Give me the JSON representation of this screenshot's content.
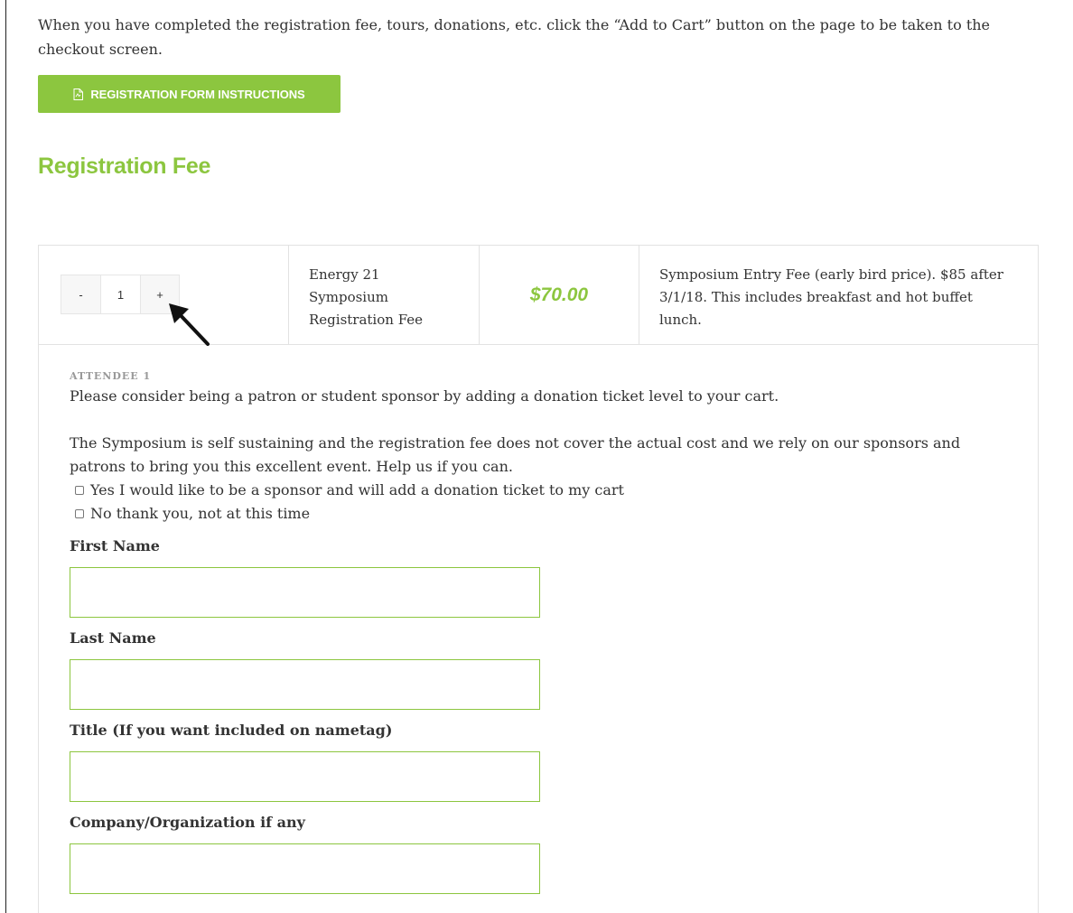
{
  "intro": {
    "text": "When you have completed the registration fee, tours, donations, etc. click the “Add to Cart” button on the page to be taken to the checkout screen."
  },
  "instructions_button": {
    "label": "REGISTRATION FORM INSTRUCTIONS",
    "icon": "pdf-file-icon"
  },
  "section": {
    "title": "Registration Fee"
  },
  "ticket": {
    "quantity": {
      "minus": "-",
      "value": "1",
      "plus": "+"
    },
    "name_lines": [
      "Energy 21",
      "Symposium",
      "Registration Fee"
    ],
    "price": "$70.00",
    "description": "Symposium Entry Fee (early bird price). $85 after 3/1/18. This includes breakfast and hot buffet lunch."
  },
  "attendee": {
    "label": "ATTENDEE 1",
    "prompt": "Please consider being a patron or student sponsor by adding a donation ticket level to your cart.",
    "note": "The Symposium is self sustaining and the registration fee does not cover the actual cost and we rely on our sponsors and patrons to bring you this excellent event. Help us if you can.",
    "options": [
      "Yes I would like to be a sponsor and will add a donation ticket to my cart",
      "No thank you, not at this time"
    ],
    "fields": [
      {
        "label": "First Name",
        "value": ""
      },
      {
        "label": "Last Name",
        "value": ""
      },
      {
        "label": "Title (If you want included on nametag)",
        "value": ""
      },
      {
        "label": "Company/Organization if any",
        "value": ""
      }
    ]
  },
  "colors": {
    "accent": "#8cc63f",
    "text": "#333333",
    "border": "#e2e2e2"
  }
}
